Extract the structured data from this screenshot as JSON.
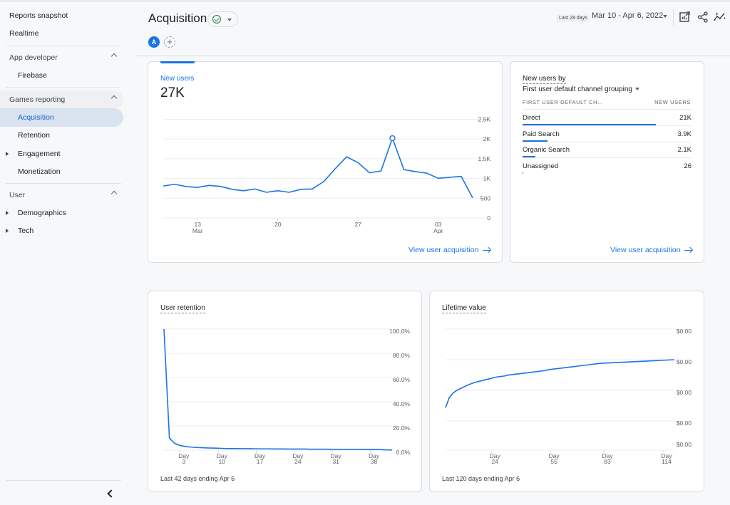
{
  "sidebar": {
    "reports_snapshot": "Reports snapshot",
    "realtime": "Realtime",
    "app_developer": "App developer",
    "firebase": "Firebase",
    "games_reporting": "Games reporting",
    "acquisition": "Acquisition",
    "retention": "Retention",
    "engagement": "Engagement",
    "monetization": "Monetization",
    "user": "User",
    "demographics": "Demographics",
    "tech": "Tech"
  },
  "header": {
    "title": "Acquisition",
    "avatar_letter": "A",
    "add_compare": "+",
    "range_label": "Last 28 days",
    "date_range": "Mar 10 - Apr 6, 2022"
  },
  "new_users_card": {
    "metric_label": "New users",
    "metric_value": "27K",
    "link": "View user acquisition",
    "chart_data": {
      "type": "line",
      "title": "New users",
      "x": [
        "Mar 10",
        "Mar 11",
        "Mar 12",
        "Mar 13",
        "Mar 14",
        "Mar 15",
        "Mar 16",
        "Mar 17",
        "Mar 18",
        "Mar 19",
        "Mar 20",
        "Mar 21",
        "Mar 22",
        "Mar 23",
        "Mar 24",
        "Mar 25",
        "Mar 26",
        "Mar 27",
        "Mar 28",
        "Mar 29",
        "Mar 30",
        "Mar 31",
        "Apr 1",
        "Apr 2",
        "Apr 3",
        "Apr 4",
        "Apr 5",
        "Apr 6"
      ],
      "values": [
        810,
        855,
        795,
        775,
        825,
        800,
        725,
        690,
        735,
        650,
        690,
        650,
        725,
        735,
        920,
        1245,
        1550,
        1400,
        1145,
        1190,
        2020,
        1225,
        1175,
        1135,
        1005,
        1030,
        1055,
        510
      ],
      "highlight_index": 20,
      "x_ticks": [
        {
          "index": 3,
          "label": "13",
          "sub": "Mar"
        },
        {
          "index": 10,
          "label": "20",
          "sub": ""
        },
        {
          "index": 17,
          "label": "27",
          "sub": ""
        },
        {
          "index": 24,
          "label": "03",
          "sub": "Apr"
        }
      ],
      "y_ticks": [
        {
          "v": 0,
          "label": "0"
        },
        {
          "v": 500,
          "label": "500"
        },
        {
          "v": 1000,
          "label": "1K"
        },
        {
          "v": 1500,
          "label": "1.5K"
        },
        {
          "v": 2000,
          "label": "2K"
        },
        {
          "v": 2500,
          "label": "2.5K"
        }
      ],
      "ylim": [
        0,
        2500
      ],
      "grid": true,
      "color": "#1a73e8"
    }
  },
  "channel_card": {
    "title": "New users by",
    "dimension": "First user default channel grouping",
    "col_dimension": "FIRST USER DEFAULT CH…",
    "col_metric": "NEW USERS",
    "rows": [
      {
        "name": "Direct",
        "value": "21K",
        "share": 0.79
      },
      {
        "name": "Paid Search",
        "value": "3.9K",
        "share": 0.146
      },
      {
        "name": "Organic Search",
        "value": "2.1K",
        "share": 0.078
      },
      {
        "name": "Unassigned",
        "value": "26",
        "share": 0.002
      }
    ],
    "link": "View user acquisition"
  },
  "retention_card": {
    "title": "User retention",
    "footer": "Last 42 days ending Apr 6",
    "chart_data": {
      "type": "line",
      "title": "User retention",
      "x_start_day": 0,
      "x_end_day": 42,
      "values": [
        100,
        10,
        5.5,
        3.8,
        3.0,
        2.5,
        2.2,
        2.0,
        1.8,
        1.7,
        1.6,
        1.4,
        1.3,
        1.3,
        1.2,
        1.2,
        1.2,
        1.1,
        1.1,
        1.1,
        1.0,
        1.0,
        1.0,
        0.9,
        0.9,
        0.9,
        0.9,
        0.8,
        0.8,
        0.8,
        0.8,
        0.7,
        0.7,
        0.7,
        0.6,
        0.6,
        0.6,
        0.6,
        0.7,
        0.6,
        0.4,
        0.2,
        0.1
      ],
      "x_ticks": [
        {
          "day": 3,
          "label": "Day",
          "sub": "3"
        },
        {
          "day": 10,
          "label": "Day",
          "sub": "10"
        },
        {
          "day": 17,
          "label": "Day",
          "sub": "17"
        },
        {
          "day": 24,
          "label": "Day",
          "sub": "24"
        },
        {
          "day": 31,
          "label": "Day",
          "sub": "31"
        },
        {
          "day": 38,
          "label": "Day",
          "sub": "38"
        }
      ],
      "y_ticks": [
        {
          "v": 0,
          "label": "0.0%"
        },
        {
          "v": 20,
          "label": "20.0%"
        },
        {
          "v": 40,
          "label": "40.0%"
        },
        {
          "v": 60,
          "label": "60.0%"
        },
        {
          "v": 80,
          "label": "80.0%"
        },
        {
          "v": 100,
          "label": "100.0%"
        }
      ],
      "ylim": [
        0,
        100
      ],
      "grid": true,
      "color": "#1a73e8"
    }
  },
  "ltv_card": {
    "title": "Lifetime value",
    "footer": "Last 120 days ending Apr 6",
    "chart_data": {
      "type": "line",
      "title": "Lifetime value",
      "x_start_day": 0,
      "x_end_day": 120,
      "values_relative": [
        0.47,
        0.58,
        0.63,
        0.66,
        0.68,
        0.7,
        0.72,
        0.735,
        0.75,
        0.76,
        0.77,
        0.78,
        0.79,
        0.8,
        0.81,
        0.815,
        0.82,
        0.83,
        0.835,
        0.84,
        0.845,
        0.85,
        0.855,
        0.86,
        0.865,
        0.87,
        0.875,
        0.88,
        0.89,
        0.895,
        0.9,
        0.905,
        0.91,
        0.915,
        0.92,
        0.925,
        0.93,
        0.935,
        0.94,
        0.945,
        0.95,
        0.955,
        0.96,
        0.962,
        0.964,
        0.966,
        0.968,
        0.97,
        0.972,
        0.974,
        0.976,
        0.978,
        0.98,
        0.982,
        0.984,
        0.986,
        0.988,
        0.99,
        0.992,
        0.994,
        0.996,
        0.998,
        1.0
      ],
      "x_ticks": [
        {
          "day": 24,
          "label": "Day",
          "sub": "24"
        },
        {
          "day": 55,
          "label": "Day",
          "sub": "55"
        },
        {
          "day": 83,
          "label": "Day",
          "sub": "83"
        },
        {
          "day": 114,
          "label": "Day",
          "sub": "114"
        }
      ],
      "y_ticks": [
        {
          "label": "$0.00"
        },
        {
          "label": "$0.00"
        },
        {
          "label": "$0.00"
        },
        {
          "label": "$0.00"
        },
        {
          "label": "$0.00"
        }
      ],
      "grid": true,
      "color": "#1a73e8"
    }
  }
}
